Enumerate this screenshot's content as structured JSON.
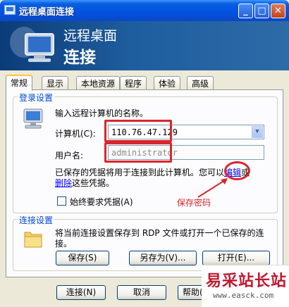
{
  "window": {
    "title": "远程桌面连接"
  },
  "titlebar_buttons": {
    "minimize": "_",
    "maximize": "□",
    "close": "✕"
  },
  "banner": {
    "line1": "远程桌面",
    "line2": "连接"
  },
  "tabs": [
    {
      "label": "常规",
      "active": true
    },
    {
      "label": "显示"
    },
    {
      "label": "本地资源"
    },
    {
      "label": "程序"
    },
    {
      "label": "体验"
    },
    {
      "label": "高级"
    }
  ],
  "logon": {
    "group_label": "登录设置",
    "instruction": "输入远程计算机的名称。",
    "computer_label": "计算机(C):",
    "computer_value": "110.76.47.129",
    "username_label": "用户名:",
    "username_value": "administrator",
    "saved_note_line1": "已保存的凭据将用于连接到此计算机。您可以",
    "edit_link": "编辑",
    "saved_note_or": "或",
    "delete_link": "删除",
    "saved_note_line2": "这些凭据。",
    "always_ask_label": "始终要求凭据(A)",
    "annotation": "保存密码"
  },
  "connection": {
    "group_label": "连接设置",
    "description_line1": "将当前连接设置保存到 RDP 文件或打开一个已保存的连",
    "description_line2": "接。",
    "save_button": "保存(S)",
    "save_as_button": "另存为(V)...",
    "open_button": "打开(E)..."
  },
  "footer": {
    "connect_button": "连接(N)",
    "cancel_button": "取消",
    "help_button": "帮助("
  },
  "watermark": {
    "name": "易采站长站",
    "url": "www.easck.com"
  },
  "colors": {
    "accent_red": "#d9262e",
    "group_label_blue": "#0046d5",
    "titlebar_blue": "#0053e0"
  }
}
